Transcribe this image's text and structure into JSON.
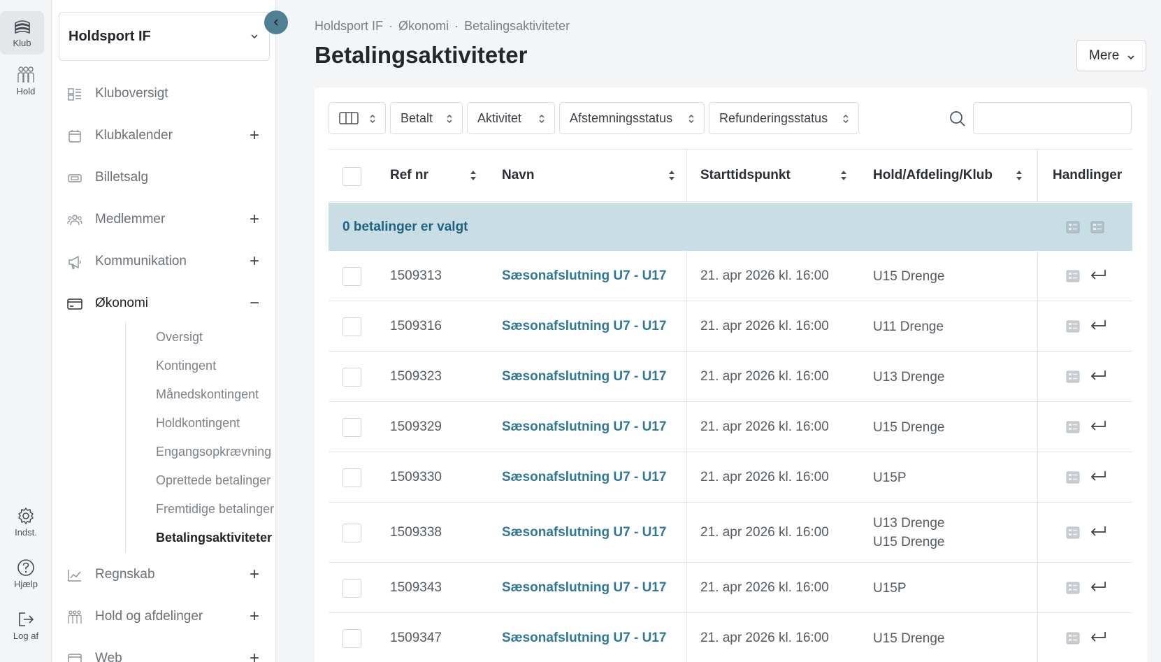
{
  "rail": {
    "items": [
      {
        "label": "Klub",
        "icon": "club-icon"
      },
      {
        "label": "Hold",
        "icon": "team-icon"
      },
      {
        "label": "Indst.",
        "icon": "gear-icon"
      },
      {
        "label": "Hjælp",
        "icon": "help-icon"
      },
      {
        "label": "Log af",
        "icon": "logout-icon"
      }
    ]
  },
  "sidebar": {
    "club_name": "Holdsport IF",
    "nav": [
      {
        "label": "Kluboversigt",
        "icon": "dashboard-icon",
        "toggle": ""
      },
      {
        "label": "Klubkalender",
        "icon": "calendar-icon",
        "toggle": "+"
      },
      {
        "label": "Billetsalg",
        "icon": "ticket-icon",
        "toggle": ""
      },
      {
        "label": "Medlemmer",
        "icon": "members-icon",
        "toggle": "+"
      },
      {
        "label": "Kommunikation",
        "icon": "megaphone-icon",
        "toggle": "+"
      },
      {
        "label": "Økonomi",
        "icon": "wallet-icon",
        "toggle": "−"
      },
      {
        "label": "Regnskab",
        "icon": "chart-icon",
        "toggle": "+"
      },
      {
        "label": "Hold og afdelinger",
        "icon": "team-icon",
        "toggle": "+"
      },
      {
        "label": "Web",
        "icon": "web-icon",
        "toggle": "+"
      }
    ],
    "sub": [
      "Oversigt",
      "Kontingent",
      "Månedskontingent",
      "Holdkontingent",
      "Engangsopkrævning",
      "Oprettede betalinger",
      "Fremtidige betalinger",
      "Betalingsaktiviteter"
    ]
  },
  "breadcrumb": [
    "Holdsport IF",
    "Økonomi",
    "Betalingsaktiviteter"
  ],
  "breadcrumb_sep": "·",
  "title": "Betalingsaktiviteter",
  "more_label": "Mere",
  "filters": [
    "Betalt",
    "Aktivitet",
    "Afstemningsstatus",
    "Refunderingsstatus"
  ],
  "search": {
    "value": "",
    "placeholder": ""
  },
  "table": {
    "columns": [
      "Ref nr",
      "Navn",
      "Starttidspunkt",
      "Hold/Afdeling/Klub",
      "Handlinger"
    ],
    "selection_text": "0 betalinger er valgt",
    "rows": [
      {
        "ref": "1509313",
        "navn": "Sæsonafslutning U7 - U17",
        "start": "21. apr 2026 kl. 16:00",
        "hold": [
          "U15 Drenge"
        ]
      },
      {
        "ref": "1509316",
        "navn": "Sæsonafslutning U7 - U17",
        "start": "21. apr 2026 kl. 16:00",
        "hold": [
          "U11 Drenge"
        ]
      },
      {
        "ref": "1509323",
        "navn": "Sæsonafslutning U7 - U17",
        "start": "21. apr 2026 kl. 16:00",
        "hold": [
          "U13 Drenge"
        ]
      },
      {
        "ref": "1509329",
        "navn": "Sæsonafslutning U7 - U17",
        "start": "21. apr 2026 kl. 16:00",
        "hold": [
          "U15 Drenge"
        ]
      },
      {
        "ref": "1509330",
        "navn": "Sæsonafslutning U7 - U17",
        "start": "21. apr 2026 kl. 16:00",
        "hold": [
          "U15P"
        ]
      },
      {
        "ref": "1509338",
        "navn": "Sæsonafslutning U7 - U17",
        "start": "21. apr 2026 kl. 16:00",
        "hold": [
          "U13 Drenge",
          "U15 Drenge"
        ]
      },
      {
        "ref": "1509343",
        "navn": "Sæsonafslutning U7 - U17",
        "start": "21. apr 2026 kl. 16:00",
        "hold": [
          "U15P"
        ]
      },
      {
        "ref": "1509347",
        "navn": "Sæsonafslutning U7 - U17",
        "start": "21. apr 2026 kl. 16:00",
        "hold": [
          "U15 Drenge"
        ]
      }
    ]
  },
  "colors": {
    "accent": "#2f7896",
    "selection_bar": "#c9dde4",
    "collapse_button": "#4e7f93"
  }
}
